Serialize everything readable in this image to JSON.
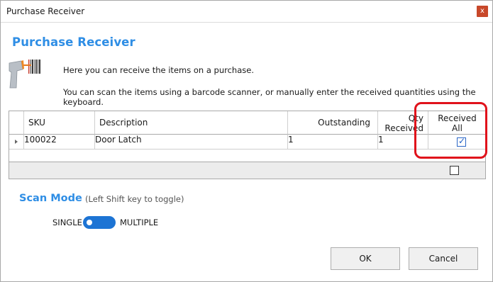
{
  "window": {
    "title": "Purchase Receiver",
    "close_label": "x"
  },
  "header": {
    "heading": "Purchase Receiver",
    "icon": "barcode-scanner-icon",
    "info_line_1": "Here you can receive the items on a purchase.",
    "info_line_2": "You can scan the items using a barcode scanner, or manually enter the received quantities using the keyboard."
  },
  "grid": {
    "columns": {
      "sku": "SKU",
      "description": "Description",
      "outstanding": "Outstanding",
      "qty_received_line1": "Qty",
      "qty_received_line2": "Received",
      "received_all_line1": "Received",
      "received_all_line2": "All"
    },
    "rows": [
      {
        "sku": "100022",
        "description": "Door Latch",
        "outstanding": "1",
        "qty_received": "1",
        "received_all": true
      }
    ],
    "footer_received_all": false
  },
  "scan_mode": {
    "title": "Scan Mode",
    "hint": "(Left Shift key to toggle)",
    "single_label": "SINGLE",
    "multiple_label": "MULTIPLE",
    "value": "SINGLE"
  },
  "buttons": {
    "ok": "OK",
    "cancel": "Cancel"
  },
  "colors": {
    "accent": "#2f8ee5",
    "toggle": "#1d74d4",
    "highlight": "#e0121b"
  }
}
